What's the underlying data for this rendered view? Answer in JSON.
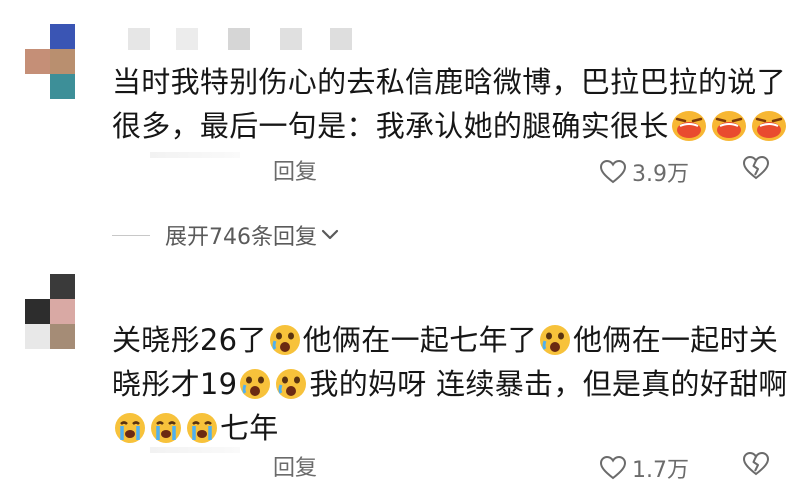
{
  "comments": [
    {
      "text_line1": "当时我特别伤心的去私信鹿晗微博，巴拉巴拉的说了",
      "text_line2": "很多，最后一句是：我承认她的腿确实很长",
      "reply_label": "回复",
      "likes": "3.9万"
    },
    {
      "seg1": "关晓彤26了",
      "seg2": "他俩在一起七年了",
      "seg3": "他俩在一起时关",
      "seg4": "晓彤才19",
      "seg5": "我的妈呀 连续暴击，但是真的好甜啊",
      "seg6": "七年",
      "reply_label": "回复",
      "likes": "1.7万"
    }
  ],
  "expand_replies_label": "展开746条回复",
  "icons": [
    "heart-outline-icon",
    "dislike-heart-icon",
    "chevron-down-icon",
    "laughing-emoji-icon",
    "crying-emoji-icon"
  ]
}
